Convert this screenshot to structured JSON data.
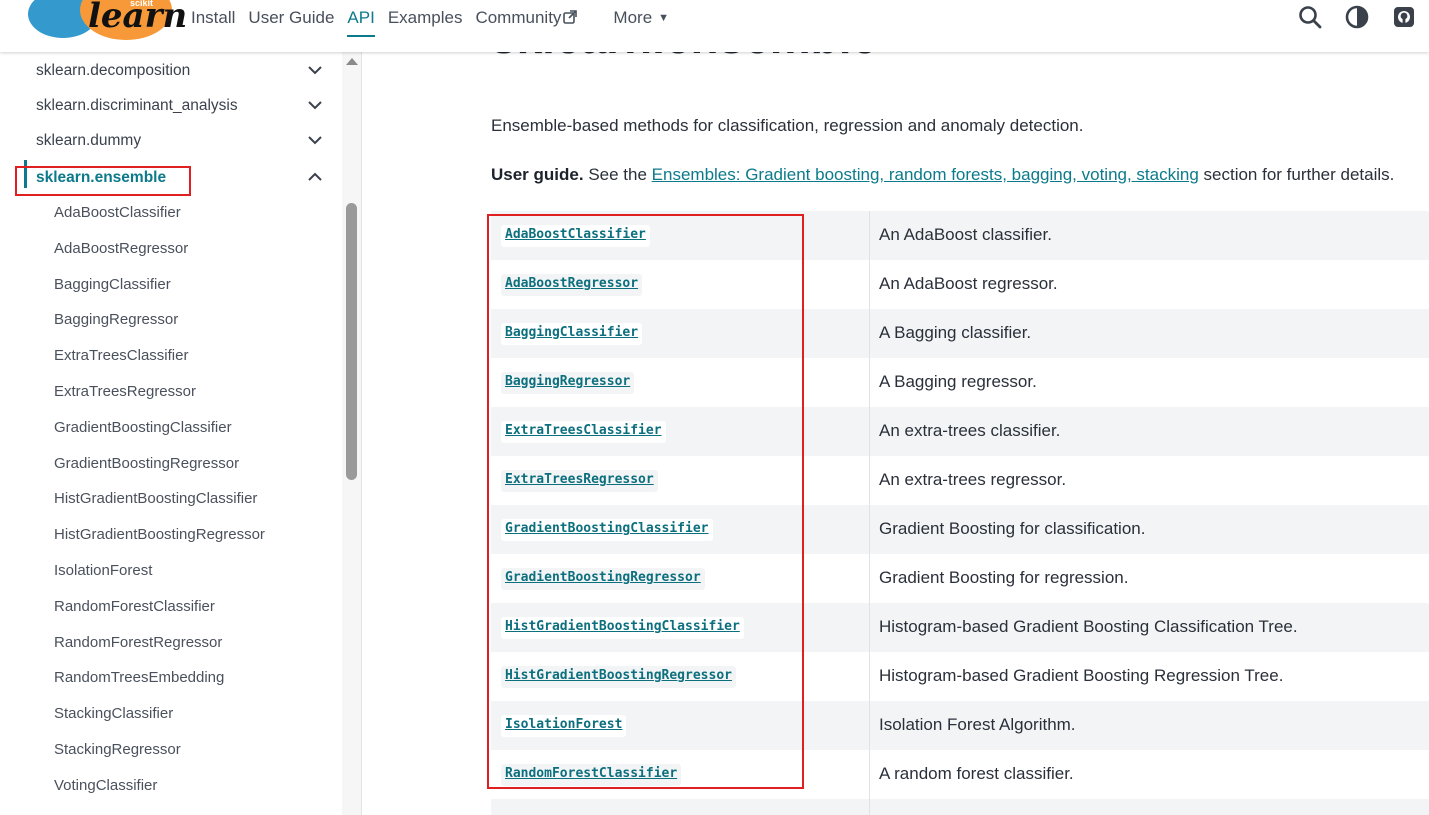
{
  "navbar": {
    "logo_small": "scikit",
    "logo_text": "learn",
    "links": [
      {
        "label": "Install",
        "active": false
      },
      {
        "label": "User Guide",
        "active": false
      },
      {
        "label": "API",
        "active": true
      },
      {
        "label": "Examples",
        "active": false
      },
      {
        "label": "Community",
        "active": false,
        "external": true
      },
      {
        "label": "More",
        "active": false,
        "dropdown": true
      }
    ],
    "icons": [
      "search-icon",
      "theme-toggle-icon",
      "github-icon"
    ],
    "accent_color": "#0c7a8a"
  },
  "sidebar": {
    "modules": [
      {
        "label": "sklearn.decomposition",
        "expanded": false
      },
      {
        "label": "sklearn.discriminant_analysis",
        "expanded": false
      },
      {
        "label": "sklearn.dummy",
        "expanded": false
      },
      {
        "label": "sklearn.ensemble",
        "expanded": true,
        "active": true
      }
    ],
    "children": [
      "AdaBoostClassifier",
      "AdaBoostRegressor",
      "BaggingClassifier",
      "BaggingRegressor",
      "ExtraTreesClassifier",
      "ExtraTreesRegressor",
      "GradientBoostingClassifier",
      "GradientBoostingRegressor",
      "HistGradientBoostingClassifier",
      "HistGradientBoostingRegressor",
      "IsolationForest",
      "RandomForestClassifier",
      "RandomForestRegressor",
      "RandomTreesEmbedding",
      "StackingClassifier",
      "StackingRegressor",
      "VotingClassifier"
    ]
  },
  "main": {
    "title": "sklearn.ensemble",
    "intro": "Ensemble-based methods for classification, regression and anomaly detection.",
    "user_guide_label": "User guide.",
    "user_guide_pre": " See the ",
    "user_guide_link": "Ensembles: Gradient boosting, random forests, bagging, voting, stacking",
    "user_guide_post": " section for further details.",
    "api_rows": [
      {
        "name": "AdaBoostClassifier",
        "desc": "An AdaBoost classifier."
      },
      {
        "name": "AdaBoostRegressor",
        "desc": "An AdaBoost regressor."
      },
      {
        "name": "BaggingClassifier",
        "desc": "A Bagging classifier."
      },
      {
        "name": "BaggingRegressor",
        "desc": "A Bagging regressor."
      },
      {
        "name": "ExtraTreesClassifier",
        "desc": "An extra-trees classifier."
      },
      {
        "name": "ExtraTreesRegressor",
        "desc": "An extra-trees regressor."
      },
      {
        "name": "GradientBoostingClassifier",
        "desc": "Gradient Boosting for classification."
      },
      {
        "name": "GradientBoostingRegressor",
        "desc": "Gradient Boosting for regression."
      },
      {
        "name": "HistGradientBoostingClassifier",
        "desc": "Histogram-based Gradient Boosting Classification Tree."
      },
      {
        "name": "HistGradientBoostingRegressor",
        "desc": "Histogram-based Gradient Boosting Regression Tree."
      },
      {
        "name": "IsolationForest",
        "desc": "Isolation Forest Algorithm."
      },
      {
        "name": "RandomForestClassifier",
        "desc": "A random forest classifier."
      },
      {
        "name": "",
        "desc": ""
      }
    ]
  },
  "annotation_color": "#e02020"
}
